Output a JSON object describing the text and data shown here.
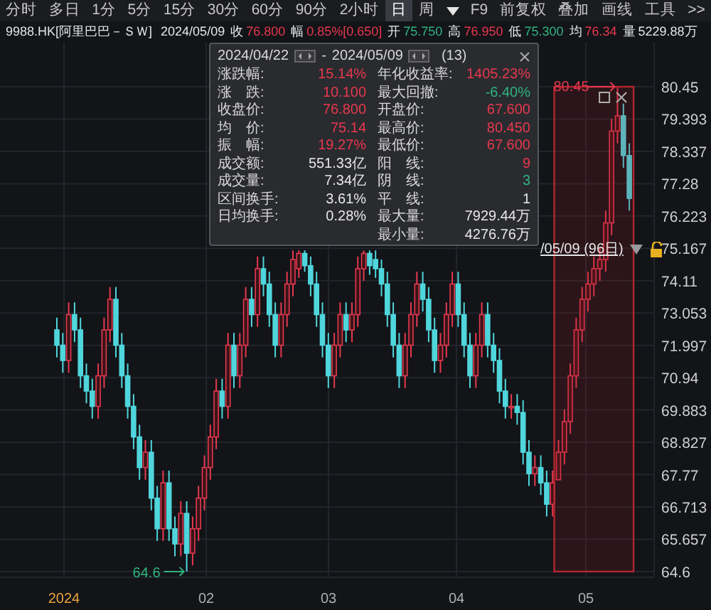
{
  "toolbar": {
    "tabs": [
      {
        "label": "分时",
        "selected": false
      },
      {
        "label": "多日",
        "selected": false
      },
      {
        "label": "1分",
        "selected": false
      },
      {
        "label": "5分",
        "selected": false
      },
      {
        "label": "15分",
        "selected": false
      },
      {
        "label": "30分",
        "selected": false
      },
      {
        "label": "60分",
        "selected": false
      },
      {
        "label": "90分",
        "selected": false
      },
      {
        "label": "2小时",
        "selected": false
      },
      {
        "label": "日",
        "selected": true
      },
      {
        "label": "周",
        "selected": false
      }
    ],
    "buttons": [
      "F9",
      "前复权",
      "叠加",
      "画线",
      "工具"
    ],
    "more": ">>"
  },
  "quote": {
    "symbol": "9988.HK[阿里巴巴－ＳＷ]",
    "date": "2024/05/09",
    "fields": [
      {
        "label": "收",
        "value": "76.800",
        "color": "#e8384f"
      },
      {
        "label": "幅",
        "value": "0.85%[0.650]",
        "color": "#e8384f"
      },
      {
        "label": "开",
        "value": "75.750",
        "color": "#2fb37e"
      },
      {
        "label": "高",
        "value": "76.950",
        "color": "#e8384f"
      },
      {
        "label": "低",
        "value": "75.300",
        "color": "#2fb37e"
      },
      {
        "label": "均",
        "value": "76.34",
        "color": "#e8384f"
      },
      {
        "label": "量",
        "value": "5229.88万",
        "color": "#e6e6e6"
      }
    ]
  },
  "chart": {
    "chart_data": {
      "type": "candlestick",
      "grid": true,
      "ylim": [
        64.6,
        80.45
      ],
      "yticks": [
        80.45,
        79.393,
        78.337,
        77.28,
        76.223,
        75.167,
        74.11,
        73.053,
        71.997,
        70.94,
        69.883,
        68.827,
        67.77,
        66.713,
        65.657,
        64.6
      ],
      "ohlc": [
        [
          72.5,
          72.9,
          71.6,
          72
        ],
        [
          72,
          72.4,
          71.1,
          71.5
        ],
        [
          71.5,
          73.4,
          71.1,
          73
        ],
        [
          73,
          73.4,
          72.1,
          72.5
        ],
        [
          72.5,
          72.9,
          70.6,
          71
        ],
        [
          71,
          71.4,
          70.1,
          70.5
        ],
        [
          70.5,
          70.9,
          69.6,
          70
        ],
        [
          70,
          71.4,
          69.6,
          71
        ],
        [
          71,
          72.9,
          70.6,
          72.5
        ],
        [
          72.5,
          73.9,
          72.1,
          73.5
        ],
        [
          73.5,
          73.9,
          71.6,
          72
        ],
        [
          72,
          72.4,
          70.6,
          71
        ],
        [
          71,
          71.4,
          69.6,
          70
        ],
        [
          70,
          70.4,
          68.6,
          69
        ],
        [
          69,
          69.4,
          67.6,
          68
        ],
        [
          68,
          68.9,
          67.6,
          68.5
        ],
        [
          68.5,
          68.9,
          66.6,
          67
        ],
        [
          67,
          67.4,
          65.6,
          66
        ],
        [
          66,
          67.9,
          65.6,
          67.5
        ],
        [
          67.5,
          67.9,
          65.6,
          66
        ],
        [
          66,
          66.4,
          65.1,
          65.5
        ],
        [
          65.5,
          66.9,
          65.1,
          66.5
        ],
        [
          66.5,
          66.9,
          64.6,
          65.2
        ],
        [
          65.2,
          66.4,
          64.8,
          66
        ],
        [
          66,
          67.4,
          65.6,
          67
        ],
        [
          67,
          68.4,
          66.6,
          68
        ],
        [
          68,
          69.4,
          67.6,
          69
        ],
        [
          69,
          70.9,
          68.6,
          70.5
        ],
        [
          70.5,
          70.9,
          69.6,
          70
        ],
        [
          70,
          72.4,
          69.6,
          72
        ],
        [
          72,
          72.4,
          70.6,
          71
        ],
        [
          71,
          72.4,
          70.6,
          72
        ],
        [
          72,
          73.9,
          71.6,
          73.5
        ],
        [
          73.5,
          73.9,
          72.6,
          73
        ],
        [
          73,
          74.9,
          72.6,
          74.5
        ],
        [
          74.5,
          74.9,
          73.6,
          74
        ],
        [
          74,
          74.4,
          72.6,
          73
        ],
        [
          73,
          73.4,
          71.6,
          72
        ],
        [
          72,
          73.4,
          71.6,
          73
        ],
        [
          73,
          74.4,
          72.6,
          74
        ],
        [
          74,
          75.1,
          73.6,
          74.8
        ],
        [
          74.5,
          75.1,
          74.2,
          75
        ],
        [
          75,
          75.1,
          74.4,
          74.6
        ],
        [
          74.6,
          74.9,
          73.6,
          74
        ],
        [
          74,
          74.4,
          72.6,
          73
        ],
        [
          73,
          73.4,
          71.6,
          72
        ],
        [
          72,
          72.4,
          70.6,
          71
        ],
        [
          71,
          72.4,
          70.6,
          72
        ],
        [
          72,
          73.4,
          71.6,
          73
        ],
        [
          73,
          73.4,
          72.1,
          72.5
        ],
        [
          72.5,
          73.4,
          72.1,
          73
        ],
        [
          73,
          74.9,
          72.6,
          74.5
        ],
        [
          74.5,
          75.1,
          74.1,
          75
        ],
        [
          75,
          75.1,
          74.3,
          74.6
        ],
        [
          74.8,
          75.1,
          74.2,
          74.5
        ],
        [
          74.5,
          74.8,
          73.6,
          74
        ],
        [
          74,
          74.4,
          72.6,
          73
        ],
        [
          73,
          73.4,
          71.6,
          72
        ],
        [
          72,
          72.4,
          70.6,
          71
        ],
        [
          71,
          72.4,
          70.6,
          72
        ],
        [
          72,
          73.4,
          71.6,
          73
        ],
        [
          73,
          74.4,
          72.6,
          74
        ],
        [
          74,
          74.4,
          73.1,
          73.5
        ],
        [
          73.5,
          73.9,
          72.1,
          72.5
        ],
        [
          72.5,
          72.9,
          71.1,
          71.5
        ],
        [
          71.5,
          72.4,
          71.1,
          72
        ],
        [
          72,
          73.4,
          71.6,
          73
        ],
        [
          73,
          74.4,
          72.6,
          74
        ],
        [
          74,
          74.4,
          72.6,
          73
        ],
        [
          73,
          73.4,
          71.6,
          72
        ],
        [
          72,
          72.4,
          70.6,
          71
        ],
        [
          71,
          72.4,
          70.6,
          72
        ],
        [
          72,
          73.4,
          71.6,
          73
        ],
        [
          73,
          73.4,
          71.6,
          72
        ],
        [
          72,
          72.4,
          71.1,
          71.5
        ],
        [
          71.5,
          71.9,
          70.1,
          70.5
        ],
        [
          70.5,
          70.9,
          69.6,
          70
        ],
        [
          70,
          70.4,
          69.6,
          70
        ],
        [
          70,
          70.4,
          69.4,
          69.8
        ],
        [
          69.8,
          70.2,
          68.1,
          68.5
        ],
        [
          68.5,
          68.9,
          67.4,
          67.8
        ],
        [
          67.8,
          68.4,
          67.4,
          68
        ],
        [
          68,
          68.4,
          67.1,
          67.5
        ],
        [
          67.5,
          67.9,
          66.4,
          66.8
        ],
        [
          66.8,
          67.9,
          66.4,
          67.5
        ],
        [
          67.6,
          68.9,
          67.6,
          68.5
        ],
        [
          68.5,
          69.9,
          68.1,
          69.5
        ],
        [
          69.5,
          71.4,
          69.1,
          71
        ],
        [
          71,
          72.9,
          70.6,
          72.5
        ],
        [
          72.5,
          73.9,
          72.1,
          73.5
        ],
        [
          73.5,
          74.4,
          73.1,
          74
        ],
        [
          74,
          74.9,
          73.6,
          74.5
        ],
        [
          74.5,
          75.2,
          74.1,
          74.8
        ],
        [
          74.8,
          76.4,
          74.4,
          76
        ],
        [
          76,
          79.4,
          75.6,
          79
        ],
        [
          79,
          80.45,
          78.6,
          79.5
        ],
        [
          79.5,
          79.9,
          77.8,
          78.2
        ],
        [
          78.2,
          78.6,
          76.4,
          76.8
        ]
      ]
    },
    "x_axis_labels": [
      {
        "text": "2024",
        "kind": "year"
      },
      {
        "text": "02",
        "kind": "month"
      },
      {
        "text": "03",
        "kind": "month"
      },
      {
        "text": "04",
        "kind": "month"
      },
      {
        "text": "05",
        "kind": "month"
      }
    ],
    "high_marker": "80.45",
    "low_marker": "64.6",
    "range_label": "/05/09 (96日)"
  },
  "stats_popup": {
    "start": "2024/04/22",
    "separator": "-",
    "end": "2024/05/09",
    "count": "(13)",
    "left": [
      {
        "label": "涨跌幅:",
        "value": "15.14%",
        "color": "#e8384f"
      },
      {
        "label": "涨　跌:",
        "value": "10.100",
        "color": "#e8384f"
      },
      {
        "label": "收盘价:",
        "value": "76.800",
        "color": "#e8384f"
      },
      {
        "label": "均　价:",
        "value": "75.14",
        "color": "#e8384f"
      },
      {
        "label": "振　幅:",
        "value": "19.27%",
        "color": "#e8384f"
      },
      {
        "label": "成交额:",
        "value": "551.33亿",
        "color": "#e6e6e6"
      },
      {
        "label": "成交量:",
        "value": "7.34亿",
        "color": "#e6e6e6"
      },
      {
        "label": "区间换手:",
        "value": "3.61%",
        "color": "#e6e6e6"
      },
      {
        "label": "日均换手:",
        "value": "0.28%",
        "color": "#e6e6e6"
      }
    ],
    "right": [
      {
        "label": "年化收益率:",
        "value": "1405.23%",
        "color": "#e8384f"
      },
      {
        "label": "最大回撤:",
        "value": "-6.40%",
        "color": "#2fb37e"
      },
      {
        "label": "开盘价:",
        "value": "67.600",
        "color": "#e8384f"
      },
      {
        "label": "最高价:",
        "value": "80.450",
        "color": "#e8384f"
      },
      {
        "label": "最低价:",
        "value": "67.600",
        "color": "#e8384f"
      },
      {
        "label": "阳　线:",
        "value": "9",
        "color": "#e8384f"
      },
      {
        "label": "阴　线:",
        "value": "3",
        "color": "#2fb37e"
      },
      {
        "label": "平　线:",
        "value": "1",
        "color": "#e6e6e6"
      },
      {
        "label": "最大量:",
        "value": "7929.44万",
        "color": "#e6e6e6"
      },
      {
        "label": "最小量:",
        "value": "4276.76万",
        "color": "#e6e6e6"
      }
    ]
  }
}
